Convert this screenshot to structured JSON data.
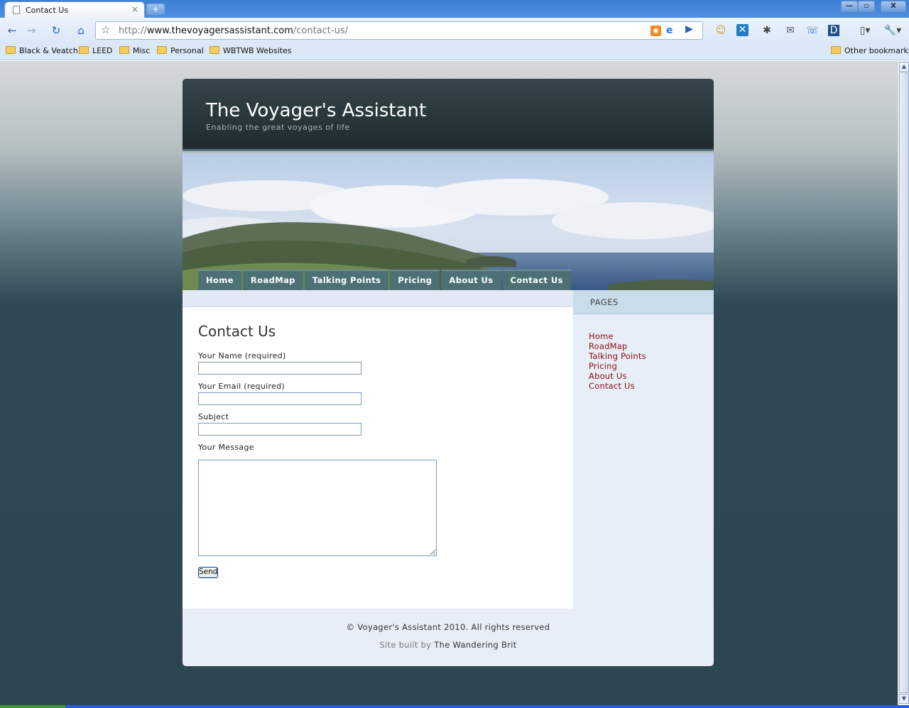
{
  "browser": {
    "tab_title": "Contact Us",
    "tab_close": "×",
    "new_tab": "+",
    "window_controls": [
      "—",
      "▫",
      "X"
    ],
    "url_prefix": "http://",
    "url_domain": "www.thevoyagersassistant.com",
    "url_path": "/contact-us/",
    "bookmarks": [
      "Black & Veatch",
      "LEED",
      "Misc",
      "Personal",
      "WBTWB Websites"
    ],
    "other_bookmarks": "Other bookmarks"
  },
  "site": {
    "title": "The Voyager's Assistant",
    "tagline": "Enabling the great voyages of life"
  },
  "nav": [
    "Home",
    "RoadMap",
    "Talking Points",
    "Pricing",
    "About Us",
    "Contact Us"
  ],
  "contact_form": {
    "heading": "Contact Us",
    "name_label": "Your Name (required)",
    "email_label": "Your Email (required)",
    "subject_label": "Subject",
    "message_label": "Your Message",
    "send_label": "Send"
  },
  "sidebar": {
    "title": "PAGES",
    "links": [
      "Home",
      "RoadMap",
      "Talking Points",
      "Pricing",
      "About Us",
      "Contact Us"
    ]
  },
  "footer": {
    "copyright": "© Voyager's Assistant 2010. All rights reserved",
    "built_by_prefix": "Site built by",
    "built_by_name": "The Wandering Brit"
  },
  "colors": {
    "header_bg": "#2a383d",
    "nav_bg": "#4d7074",
    "link_color": "#8a0e10",
    "sidebar_bg": "#e8eef8"
  }
}
